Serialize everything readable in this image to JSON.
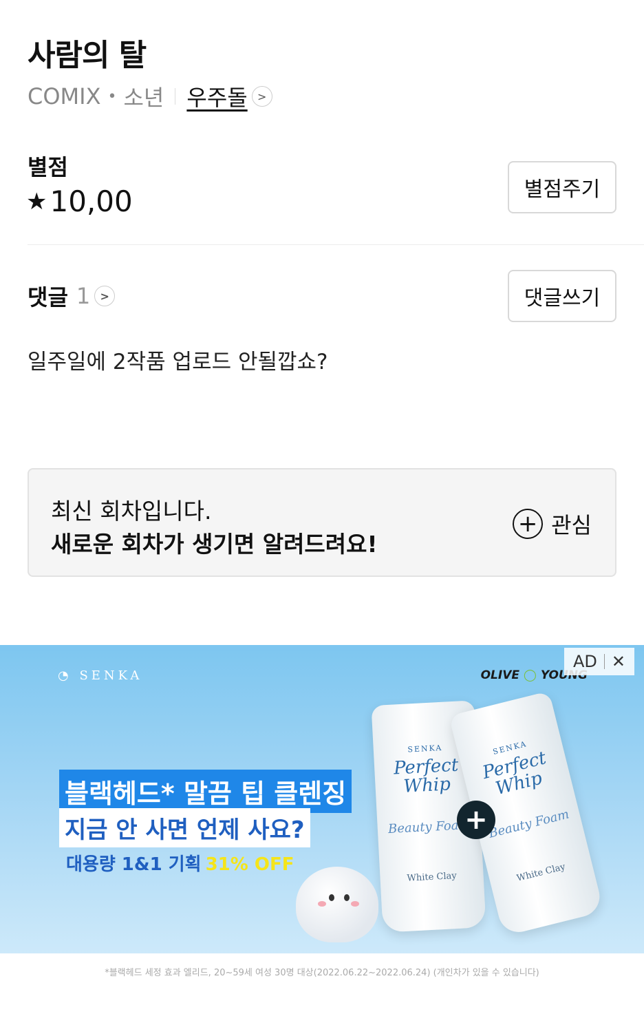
{
  "header": {
    "title": "사람의 탈",
    "platform": "COMIX",
    "genre": "소년",
    "author": "우주돌"
  },
  "rating": {
    "label": "별점",
    "star": "★",
    "value": "10,00",
    "button_label": "별점주기"
  },
  "comments": {
    "label": "댓글",
    "count": "1",
    "button_label": "댓글쓰기",
    "items": [
      {
        "text": "일주일에 2작품 업로드 안될깝쇼?"
      }
    ]
  },
  "notice": {
    "line1": "최신 회차입니다.",
    "line2": "새로운 회차가 생기면 알려드려요!",
    "favorite_label": "관심"
  },
  "ad": {
    "badge": "AD",
    "close": "✕",
    "brand": "SENKA",
    "partner_a": "OLIVE",
    "partner_b": "YOUNG",
    "headline1": "블랙헤드* 말끔 팁 클렌징",
    "headline2": "지금 안 사면 언제 사요?",
    "headline3": "대용량 1&1 기획",
    "discount": "31% OFF",
    "product_brand": "SENKA",
    "product_name": "Perfect Whip",
    "product_sub": "Beauty Foam",
    "product_variant": "White Clay",
    "disclaimer": "*블랙헤드 세정 효과 엘리드, 20~59세 여성 30명 대상(2022.06.22~2022.06.24) (개인차가 있을 수 있습니다)",
    "background_color": "#8fcef3",
    "accent_color": "#1f87e8"
  }
}
